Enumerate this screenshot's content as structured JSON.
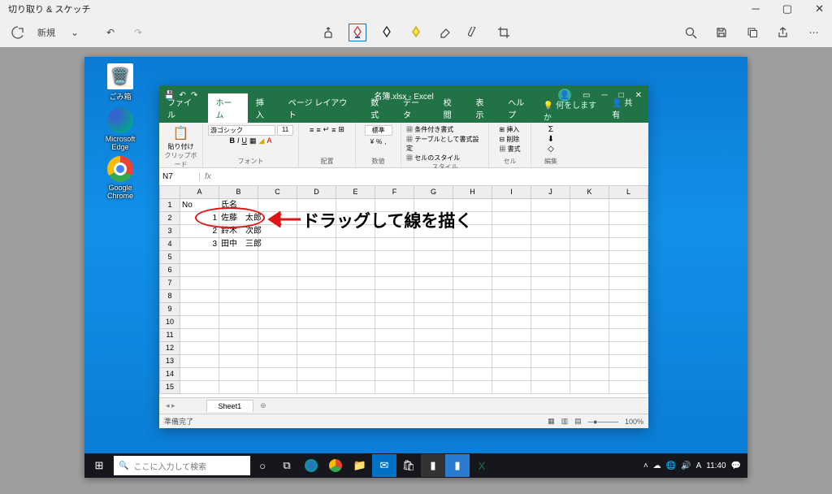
{
  "snip": {
    "title": "切り取り & スケッチ",
    "new_label": "新規"
  },
  "annotation": {
    "text": "ドラッグして線を描く"
  },
  "desktop_icons": {
    "recycle": "ごみ箱",
    "edge": "Microsoft Edge",
    "chrome": "Google Chrome"
  },
  "excel": {
    "filename": "名簿.xlsx - Excel",
    "tabs": [
      "ファイル",
      "ホーム",
      "挿入",
      "ページ レイアウト",
      "数式",
      "データ",
      "校閲",
      "表示",
      "ヘルプ"
    ],
    "tell_me": "何をしますか",
    "share": "共有",
    "ribbon_groups": {
      "clipboard": "クリップボード",
      "font": "フォント",
      "font_name": "游ゴシック",
      "font_size": "11",
      "align": "配置",
      "number": "数値",
      "number_fmt": "標準",
      "styles": "スタイル",
      "style_items": [
        "条件付き書式",
        "テーブルとして書式設定",
        "セルのスタイル"
      ],
      "cells": "セル",
      "cell_items": [
        "挿入",
        "削除",
        "書式"
      ],
      "editing": "編集",
      "clipboard_btn": "貼り付け"
    },
    "namebox": "N7",
    "columns": [
      "A",
      "B",
      "C",
      "D",
      "E",
      "F",
      "G",
      "H",
      "I",
      "J",
      "K",
      "L"
    ],
    "rows": [
      {
        "n": 1,
        "A": "No",
        "B": "氏名"
      },
      {
        "n": 2,
        "A": "1",
        "B": "佐藤　太郎"
      },
      {
        "n": 3,
        "A": "2",
        "B": "鈴木　次郎"
      },
      {
        "n": 4,
        "A": "3",
        "B": "田中　三郎"
      },
      {
        "n": 5
      },
      {
        "n": 6
      },
      {
        "n": 7
      },
      {
        "n": 8
      },
      {
        "n": 9
      },
      {
        "n": 10
      },
      {
        "n": 11
      },
      {
        "n": 12
      },
      {
        "n": 13
      },
      {
        "n": 14
      },
      {
        "n": 15
      }
    ],
    "sheet": "Sheet1",
    "status": "準備完了",
    "zoom": "100%"
  },
  "taskbar": {
    "search_placeholder": "ここに入力して検索",
    "time": "11:40"
  }
}
